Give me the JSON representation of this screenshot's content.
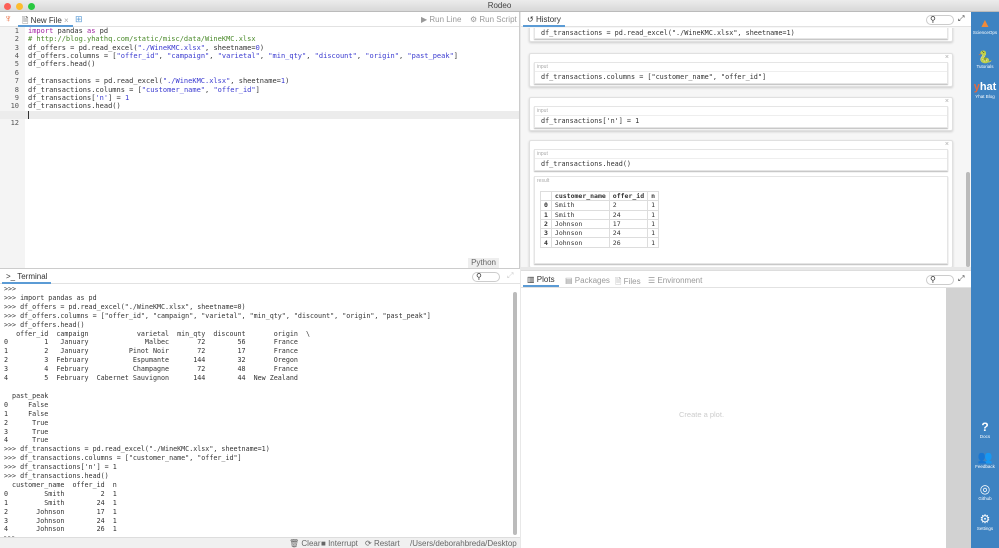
{
  "window": {
    "title": "Rodeo"
  },
  "editor": {
    "tab": "New File",
    "run_line": "Run Line",
    "run_script": "Run Script",
    "language": "Python",
    "lines": [
      "import pandas as pd",
      "# http://blog.yhathq.com/static/misc/data/WineKMC.xlsx",
      "df_offers = pd.read_excel(\"./WineKMC.xlsx\", sheetname=0)",
      "df_offers.columns = [\"offer_id\", \"campaign\", \"varietal\", \"min_qty\", \"discount\", \"origin\", \"past_peak\"]",
      "df_offers.head()",
      "",
      "df_transactions = pd.read_excel(\"./WineKMC.xlsx\", sheetname=1)",
      "df_transactions.columns = [\"customer_name\", \"offer_id\"]",
      "df_transactions['n'] = 1",
      "df_transactions.head()",
      "",
      ""
    ],
    "line_numbers": [
      "1",
      "2",
      "3",
      "4",
      "5",
      "6",
      "7",
      "8",
      "9",
      "10",
      "11",
      "12"
    ]
  },
  "terminal": {
    "tab": "Terminal",
    "search_placeholder": "",
    "output": ">>>\n>>> import pandas as pd\n>>> df_offers = pd.read_excel(\"./WineKMC.xlsx\", sheetname=0)\n>>> df_offers.columns = [\"offer_id\", \"campaign\", \"varietal\", \"min_qty\", \"discount\", \"origin\", \"past_peak\"]\n>>> df_offers.head()\n   offer_id  campaign            varietal  min_qty  discount       origin  \\\n0         1   January              Malbec       72        56       France\n1         2   January          Pinot Noir       72        17       France\n2         3  February           Espumante      144        32       Oregon\n3         4  February           Champagne       72        48       France\n4         5  February  Cabernet Sauvignon      144        44  New Zealand\n\n  past_peak\n0     False\n1     False\n2      True\n3      True\n4      True\n>>> df_transactions = pd.read_excel(\"./WineKMC.xlsx\", sheetname=1)\n>>> df_transactions.columns = [\"customer_name\", \"offer_id\"]\n>>> df_transactions['n'] = 1\n>>> df_transactions.head()\n  customer_name  offer_id  n\n0         Smith         2  1\n1         Smith        24  1\n2       Johnson        17  1\n3       Johnson        24  1\n4       Johnson        26  1\n>>> ",
    "status": {
      "clear": "Clear",
      "interrupt": "Interrupt",
      "restart": "Restart",
      "cwd": "/Users/deborahbreda/Desktop"
    }
  },
  "history": {
    "tab": "History",
    "cards": [
      {
        "code": "df_transactions = pd.read_excel(\"./WineKMC.xlsx\", sheetname=1)"
      },
      {
        "label": "input",
        "code": "df_transactions.columns = [\"customer_name\", \"offer_id\"]"
      },
      {
        "label": "input",
        "code": "df_transactions['n'] = 1"
      },
      {
        "label": "input",
        "code": "df_transactions.head()",
        "result_label": "result"
      }
    ],
    "result_table": {
      "columns": [
        "",
        "customer_name",
        "offer_id",
        "n"
      ],
      "rows": [
        [
          "0",
          "Smith",
          "2",
          "1"
        ],
        [
          "1",
          "Smith",
          "24",
          "1"
        ],
        [
          "2",
          "Johnson",
          "17",
          "1"
        ],
        [
          "3",
          "Johnson",
          "24",
          "1"
        ],
        [
          "4",
          "Johnson",
          "26",
          "1"
        ]
      ]
    }
  },
  "plots": {
    "tabs": [
      "Plots",
      "Packages",
      "Files",
      "Environment"
    ],
    "active_tab": "Plots",
    "empty_text": "Create a plot."
  },
  "sidebar": {
    "items": [
      {
        "label": "ScienceOps",
        "icon": "scienceops-logo"
      },
      {
        "label": "Tutorials",
        "icon": "python-logo"
      },
      {
        "label": "Yhat Blog",
        "icon": "yhat-logo",
        "logo_text": "yhat"
      },
      {
        "label": "Docs",
        "icon": "question-icon"
      },
      {
        "label": "Feedback",
        "icon": "users-icon"
      },
      {
        "label": "Github",
        "icon": "github-icon"
      },
      {
        "label": "Settings",
        "icon": "gears-icon"
      }
    ]
  },
  "colors": {
    "sidebar": "#3e83c2",
    "tab_accent": "#5b9bd5",
    "keyword": "#a020a0",
    "comment": "#4a8a2a",
    "string": "#3a3ad0"
  }
}
